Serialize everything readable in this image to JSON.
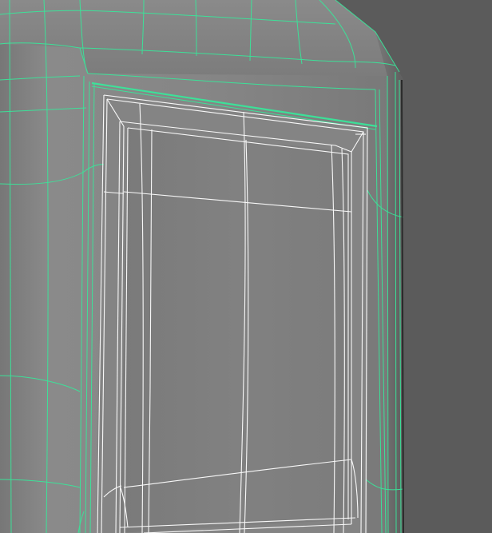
{
  "viewport": {
    "background_color": "#5a5a5a"
  },
  "colors": {
    "wire_selected": "#39e69a",
    "wire_inner": "#ffffff",
    "surface_light": "#8c8c8c",
    "surface_mid": "#7f7f7f",
    "surface_dark": "#6f6f6f",
    "panel_fill": "#808080"
  }
}
